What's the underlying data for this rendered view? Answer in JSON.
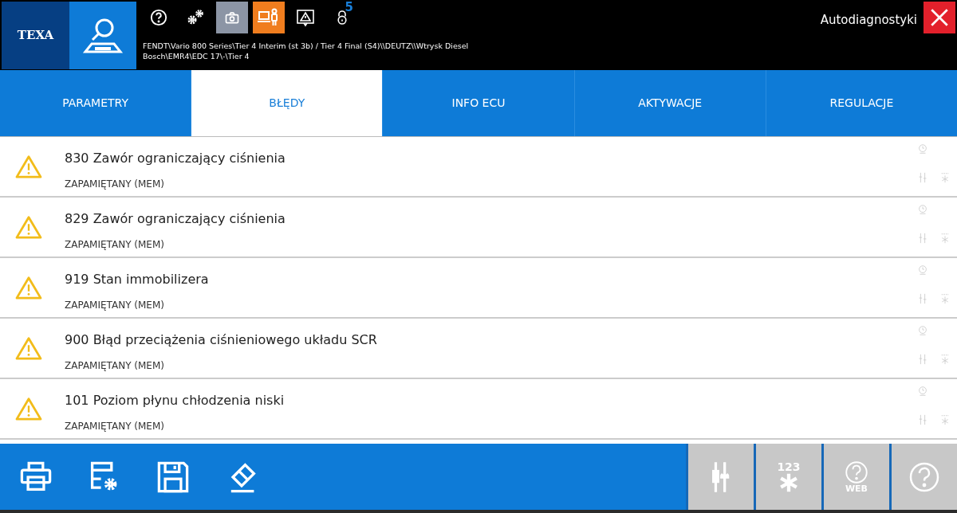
{
  "header": {
    "logo": "TEXA",
    "toolbar": [
      {
        "kind": "help"
      },
      {
        "kind": "gears"
      },
      {
        "kind": "camera"
      },
      {
        "kind": "operator"
      },
      {
        "kind": "warning"
      },
      {
        "kind": "lock",
        "badge": "5"
      }
    ],
    "path": [
      "FENDT\\Vario 800 Series\\Tier 4 Interim (st 3b) / Tier 4 Final (S4)\\\\DEUTZ\\\\Wtrysk Diesel",
      "Bosch\\EMR4\\EDC 17\\-\\Tier 4"
    ],
    "title": "Autodiagnostyki"
  },
  "tabs": [
    {
      "label": "PARAMETRY",
      "selected": false
    },
    {
      "label": "BŁĘDY",
      "selected": true
    },
    {
      "label": "INFO ECU",
      "selected": false
    },
    {
      "label": "AKTYWACJE",
      "selected": false
    },
    {
      "label": "REGULACJE",
      "selected": false
    }
  ],
  "errors": [
    {
      "title": "830 Zawór ograniczający ciśnienia",
      "status": "ZAPAMIĘTANY (MEM)"
    },
    {
      "title": "829 Zawór ograniczający ciśnienia",
      "status": "ZAPAMIĘTANY (MEM)"
    },
    {
      "title": "919 Stan immobilizera",
      "status": "ZAPAMIĘTANY (MEM)"
    },
    {
      "title": "900 Błąd przeciążenia ciśnieniowego układu SCR",
      "status": "ZAPAMIĘTANY (MEM)"
    },
    {
      "title": "101 Poziom płynu chłodzenia niski",
      "status": "ZAPAMIĘTANY (MEM)"
    }
  ],
  "bottom_bar": {
    "left_buttons": [
      {
        "kind": "print"
      },
      {
        "kind": "settings"
      },
      {
        "kind": "save"
      },
      {
        "kind": "erase"
      }
    ],
    "right_buttons": [
      {
        "kind": "sliders"
      },
      {
        "kind": "asterisk",
        "label": "123"
      },
      {
        "kind": "help",
        "label": "WEB"
      },
      {
        "kind": "help"
      }
    ]
  }
}
